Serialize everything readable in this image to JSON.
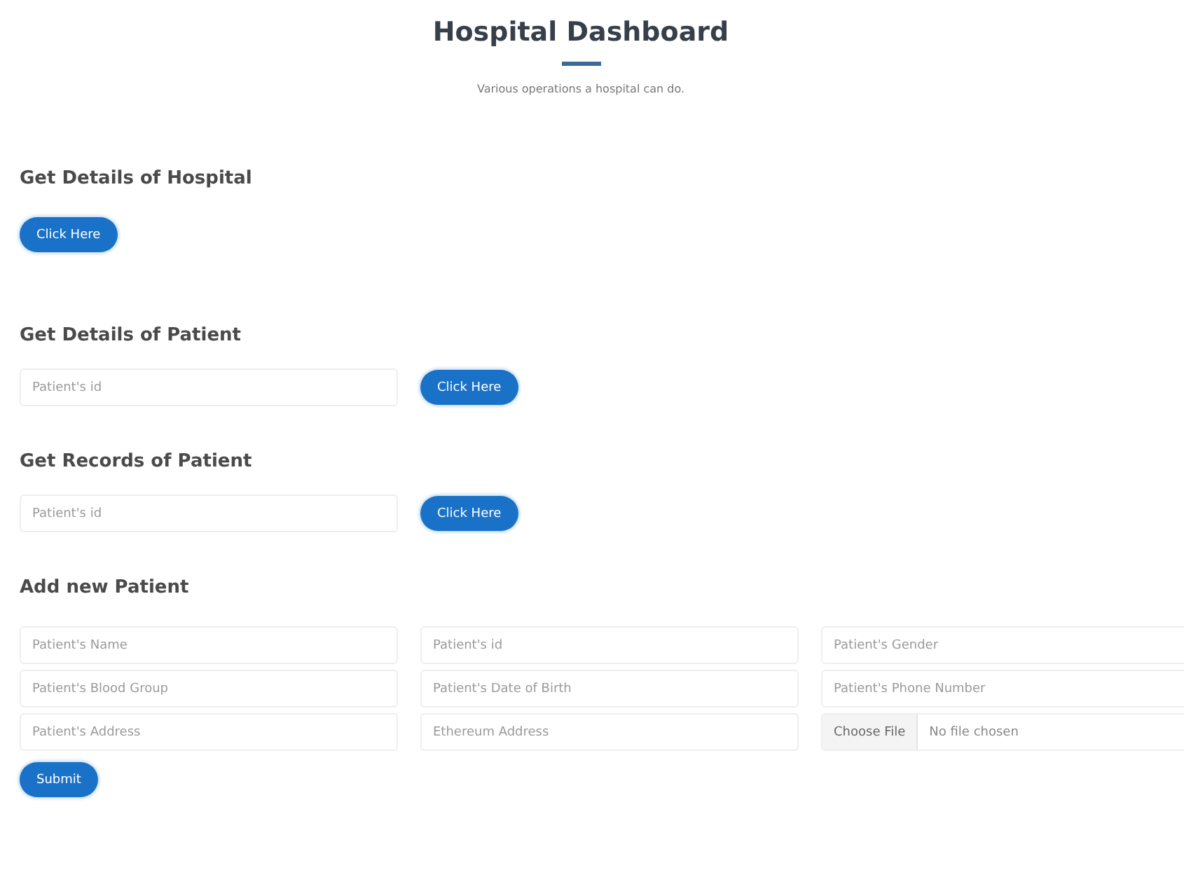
{
  "header": {
    "title": "Hospital Dashboard",
    "subtitle": "Various operations a hospital can do."
  },
  "sections": [
    {
      "kind": "button",
      "heading": "Get Details of Hospital",
      "button": "Click Here"
    },
    {
      "kind": "lookup",
      "heading": "Get Details of Patient",
      "placeholder": "Patient's id",
      "button": "Click Here"
    },
    {
      "kind": "lookup",
      "heading": "Get Records of Patient",
      "placeholder": "Patient's id",
      "button": "Click Here"
    }
  ],
  "new_patient": {
    "heading": "Add new Patient",
    "fields": [
      {
        "kind": "text",
        "placeholder": "Patient's Name"
      },
      {
        "kind": "text",
        "placeholder": "Patient's id"
      },
      {
        "kind": "text",
        "placeholder": "Patient's Gender"
      },
      {
        "kind": "text",
        "placeholder": "Patient's Blood Group"
      },
      {
        "kind": "text",
        "placeholder": "Patient's Date of Birth"
      },
      {
        "kind": "text",
        "placeholder": "Patient's Phone Number"
      },
      {
        "kind": "text",
        "placeholder": "Patient's Address"
      },
      {
        "kind": "text",
        "placeholder": "Ethereum Address"
      },
      {
        "kind": "file",
        "button": "Choose File",
        "status": "No file chosen"
      }
    ],
    "submit": "Submit"
  }
}
